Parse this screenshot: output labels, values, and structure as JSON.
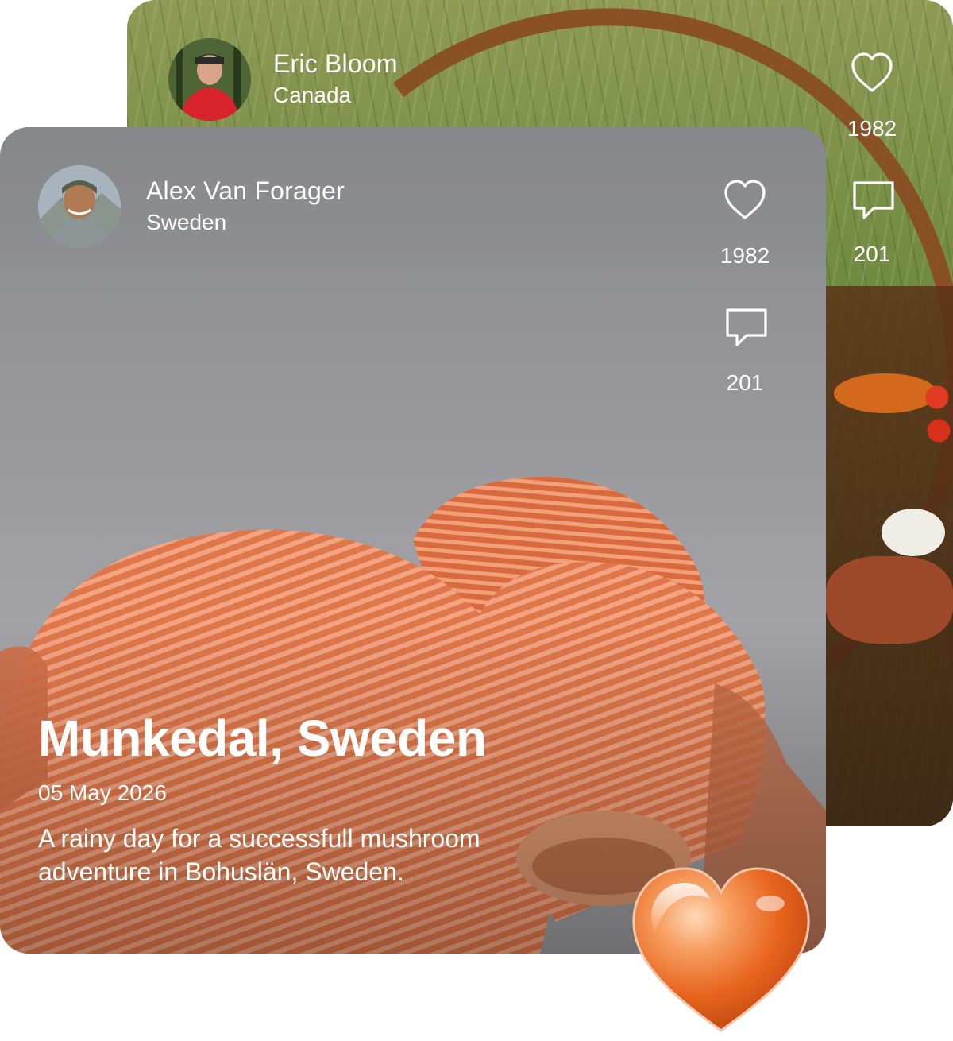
{
  "posts": [
    {
      "user": {
        "name": "Eric Bloom",
        "country": "Canada"
      },
      "likes": "1982",
      "comments": "201"
    },
    {
      "user": {
        "name": "Alex Van Forager",
        "country": "Sweden"
      },
      "likes": "1982",
      "comments": "201",
      "place": "Munkedal, Sweden",
      "date": "05 May 2026",
      "caption": "A rainy day for a successfull mushroom adventure in Bohuslän, Sweden."
    }
  ],
  "icons": {
    "like": "heart-outline-icon",
    "comment": "speech-bubble-icon",
    "reaction": "glass-heart-icon"
  },
  "colors": {
    "text": "#ffffff",
    "accent_heart": "#e8651e"
  }
}
